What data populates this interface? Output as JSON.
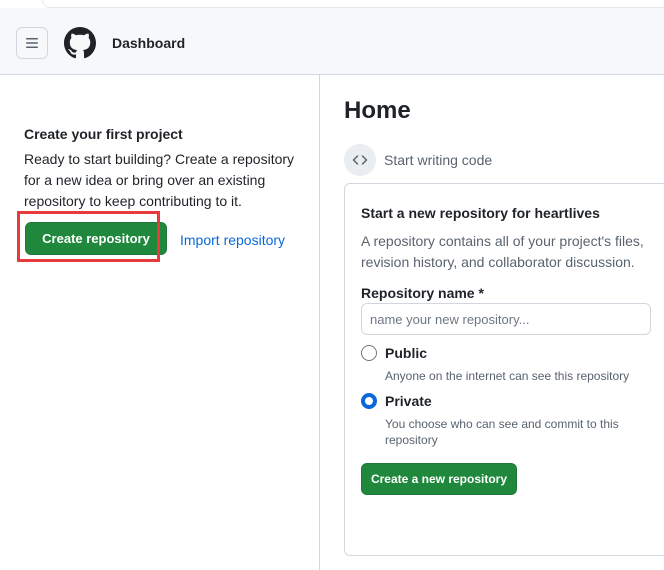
{
  "header": {
    "title": "Dashboard",
    "menu_icon": "hamburger-menu-icon",
    "logo_icon": "github-logo-icon"
  },
  "left_panel": {
    "heading": "Create your first project",
    "description": "Ready to start building? Create a repository for a new idea or bring over an existing repository to keep contributing to it.",
    "create_button": "Create repository",
    "import_link": "Import repository"
  },
  "main": {
    "title": "Home",
    "start_writing": "Start writing code",
    "code_icon": "code-brackets-icon",
    "card": {
      "title": "Start a new repository for heartlives",
      "description": "A repository contains all of your project's files, revision history, and collaborator discussion.",
      "repo_name_label": "Repository name *",
      "repo_name_placeholder": "name your new repository...",
      "repo_name_value": "",
      "options": [
        {
          "label": "Public",
          "description": "Anyone on the internet can see this repository",
          "selected": false
        },
        {
          "label": "Private",
          "description": "You choose who can see and commit to this repository",
          "selected": true
        }
      ],
      "submit_button": "Create a new repository"
    }
  },
  "colors": {
    "accent_green": "#1f883d",
    "link_blue": "#0969da",
    "highlight_red": "#e8393b",
    "header_bg": "#f6f8fa",
    "border": "#d0d7de"
  }
}
